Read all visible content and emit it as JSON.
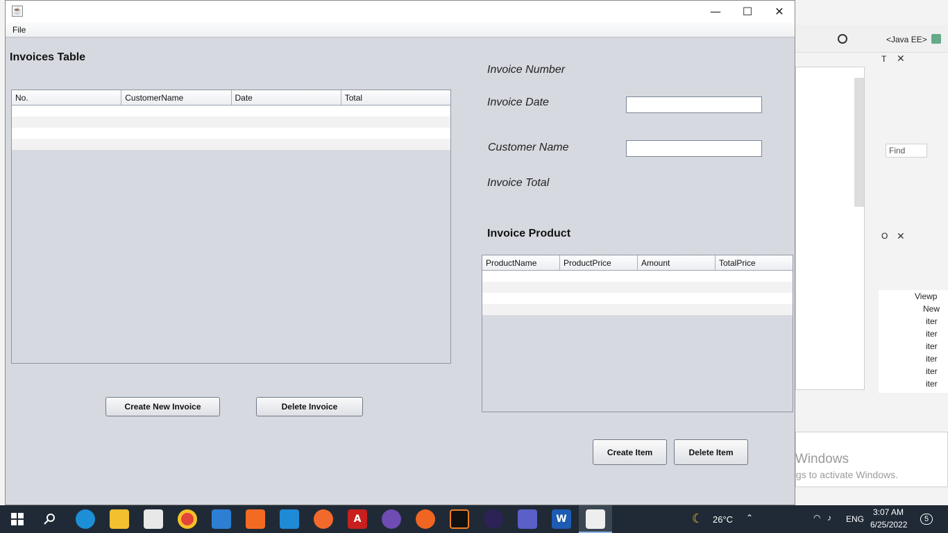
{
  "window": {
    "menu_file": "File",
    "controls": {
      "minimize": "—",
      "maximize": "☐",
      "close": "✕"
    }
  },
  "invoices": {
    "title": "Invoices Table",
    "columns": [
      "No.",
      "CustomerName",
      "Date",
      "Total"
    ],
    "create_button": "Create New Invoice",
    "delete_button": "Delete Invoice"
  },
  "details": {
    "invoice_number_label": "Invoice Number",
    "invoice_date_label": "Invoice Date",
    "invoice_date_value": "",
    "customer_name_label": "Customer Name",
    "customer_name_value": "",
    "invoice_total_label": "Invoice Total",
    "product_title": "Invoice Product",
    "product_columns": [
      "ProductName",
      "ProductPrice",
      "Amount",
      "TotalPrice"
    ],
    "create_item_button": "Create Item",
    "delete_item_button": "Delete Item"
  },
  "background_ide": {
    "perspective": "<Java EE>",
    "find_placeholder": "Find",
    "outline_tab": "O",
    "task_tab": "T",
    "tree_items": [
      "Viewp",
      "New",
      "iter",
      "iter",
      "iter",
      "iter",
      "iter",
      "iter"
    ]
  },
  "watermark": {
    "line1": "Activate Windows",
    "line2": "Go to Settings to activate Windows."
  },
  "taskbar": {
    "weather": "26°C",
    "language": "ENG",
    "time": "3:07 AM",
    "date": "6/25/2022",
    "notifications": "5"
  }
}
